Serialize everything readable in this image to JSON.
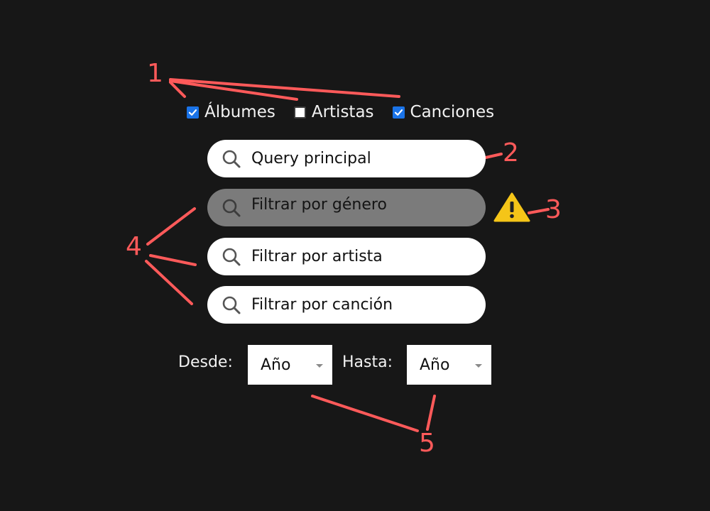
{
  "filters": {
    "types": [
      {
        "label": "Álbumes",
        "checked": true
      },
      {
        "label": "Artistas",
        "checked": false
      },
      {
        "label": "Canciones",
        "checked": true
      }
    ]
  },
  "search": {
    "main": {
      "placeholder": "Query principal",
      "icon": "search-icon"
    },
    "genre": {
      "placeholder": "Filtrar por género",
      "icon": "search-icon",
      "disabled": true
    },
    "artist": {
      "placeholder": "Filtrar por artista",
      "icon": "search-icon"
    },
    "song": {
      "placeholder": "Filtrar por canción",
      "icon": "search-icon"
    }
  },
  "warning": {
    "icon": "warning-icon",
    "color": "#f5c518"
  },
  "date_range": {
    "from_label": "Desde:",
    "from_value": "Año",
    "to_label": "Hasta:",
    "to_value": "Año"
  },
  "annotations": {
    "color": "#ff5a5a",
    "numbers": [
      "1",
      "2",
      "3",
      "4",
      "5"
    ]
  },
  "colors": {
    "background": "#171717",
    "checkbox_accent": "#1a73e8",
    "disabled_field": "#7b7b7b"
  }
}
